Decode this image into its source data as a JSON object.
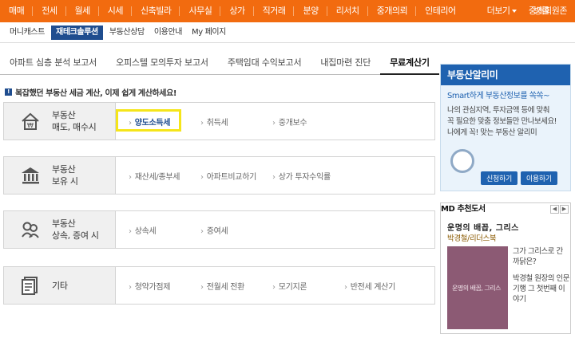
{
  "topnav": {
    "items": [
      "매매",
      "전세",
      "월세",
      "시세",
      "신축빌라",
      "사무실",
      "상가",
      "직거래",
      "분양",
      "리서치",
      "중개의뢰",
      "인테리어"
    ],
    "more": "더보기",
    "extra": "방콜",
    "join": "중개회원존",
    "bg_color": "#f26b0f"
  },
  "subnav": {
    "items": [
      "머니캐스트",
      "재테크솔루션",
      "부동산상담",
      "이용안내",
      "My 페이지"
    ],
    "active_index": 1
  },
  "tabs": [
    "아파트 심층 분석 보고서",
    "오피스텔 모의투자 보고서",
    "주택임대 수익보고서",
    "내집마련 진단",
    "무료계산기"
  ],
  "active_tab": 4,
  "notice": "복잡했던 부동산 세금 계산, 이제 쉽게 계산하세요!",
  "rows": [
    {
      "label1": "부동산",
      "label2": "매도, 매수시",
      "icon": "house-money-icon",
      "links": [
        "양도소득세",
        "취득세",
        "중개보수"
      ]
    },
    {
      "label1": "부동산",
      "label2": "보유 시",
      "icon": "bank-icon",
      "links": [
        "재산세/종부세",
        "아파트비교하기",
        "상가 투자수익률"
      ]
    },
    {
      "label1": "부동산",
      "label2": "상속, 증여 시",
      "icon": "people-icon",
      "links": [
        "상속세",
        "증여세"
      ]
    },
    {
      "label1": "기타",
      "label2": "",
      "icon": "document-icon",
      "links": [
        "청약가점제",
        "전월세 전환",
        "모기지론",
        "반전세 계산기"
      ]
    }
  ],
  "ad": {
    "title": "부동산알리미",
    "subtitle": "Smart하게 부동산정보를 쏙쏙~",
    "desc1": "나의 관심지역, 투자금액 등에 맞춰",
    "desc2": "꼭 필요한 맞춤 정보들만 만나보세요!",
    "desc3": "나에게 꼭! 맞는 부동산 알리미",
    "btn_apply": "신청하기",
    "btn_use": "이용하기"
  },
  "md": {
    "heading": "MD 추천도서",
    "book_title": "운명의 배꼽, 그리스",
    "author": "박경철/리더스북",
    "blurb1": "그가 그리스로 간 까닭은?",
    "blurb2": "박경철 원장의 인문기행 그 첫번째 이야기",
    "cover_text": "운명의 배꼽, 그리스"
  }
}
